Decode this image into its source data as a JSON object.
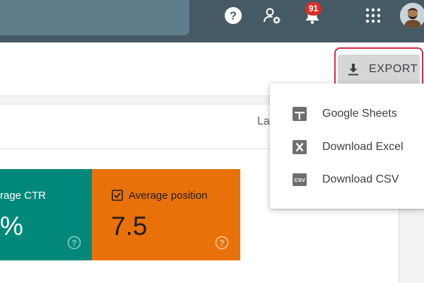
{
  "topbar": {
    "notification_count": "91",
    "icons": [
      "help-icon",
      "admin-settings-icon",
      "notifications-bell-icon",
      "apps-grid-icon",
      "user-avatar"
    ]
  },
  "header": {
    "export_label": "EXPORT"
  },
  "filters": {
    "partial_label": "La"
  },
  "metrics": {
    "ctr": {
      "title": "rage CTR",
      "value": "%",
      "color": "#00897b"
    },
    "position": {
      "title": "Average position",
      "value": "7.5",
      "color": "#e8710a",
      "checked": true
    }
  },
  "export_menu": {
    "items": [
      {
        "label": "Google Sheets",
        "icon": "google-sheets-icon"
      },
      {
        "label": "Download Excel",
        "icon": "excel-icon"
      },
      {
        "label": "Download CSV",
        "icon": "csv-icon",
        "icon_text": "CSV"
      }
    ]
  },
  "colors": {
    "topbar": "#455a64",
    "accent_red": "#d32f45",
    "badge": "#d93025"
  }
}
